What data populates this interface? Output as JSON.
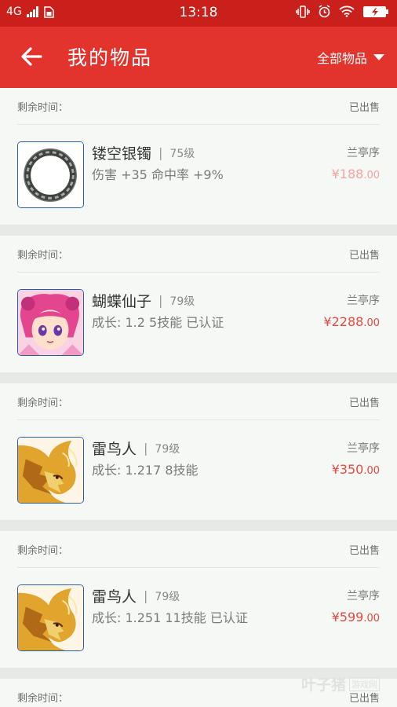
{
  "status_bar": {
    "network": "4G",
    "time": "13:18"
  },
  "header": {
    "back_icon": "arrow-left-icon",
    "title": "我的物品",
    "filter_label": "全部物品"
  },
  "items": [
    {
      "remain_label": "剩余时间：",
      "status": "已出售",
      "name": "镂空银镯",
      "level": "75级",
      "attrs": "伤害 +35 命中率 +9%",
      "seller": "兰亭序",
      "price_main": "¥188",
      "price_dec": ".00",
      "price_color": "#f5a3a0",
      "thumb": "bracelet-image"
    },
    {
      "remain_label": "剩余时间：",
      "status": "已出售",
      "name": "蝴蝶仙子",
      "level": "79级",
      "attrs": "成长: 1.2  5技能  已认证",
      "seller": "兰亭序",
      "price_main": "¥2288",
      "price_dec": ".00",
      "price_color": "#e44942",
      "thumb": "butterfly-fairy-image"
    },
    {
      "remain_label": "剩余时间：",
      "status": "已出售",
      "name": "雷鸟人",
      "level": "79级",
      "attrs": "成长: 1.217  8技能",
      "seller": "兰亭序",
      "price_main": "¥350",
      "price_dec": ".00",
      "price_color": "#e44942",
      "thumb": "thunderbird-image"
    },
    {
      "remain_label": "剩余时间：",
      "status": "已出售",
      "name": "雷鸟人",
      "level": "79级",
      "attrs": "成长: 1.251  11技能  已认证",
      "seller": "兰亭序",
      "price_main": "¥599",
      "price_dec": ".00",
      "price_color": "#e44942",
      "thumb": "thunderbird-image"
    },
    {
      "remain_label": "剩余时间：",
      "status": "已出售"
    }
  ],
  "watermark": {
    "text": "叶子猪",
    "box": "游戏网"
  }
}
